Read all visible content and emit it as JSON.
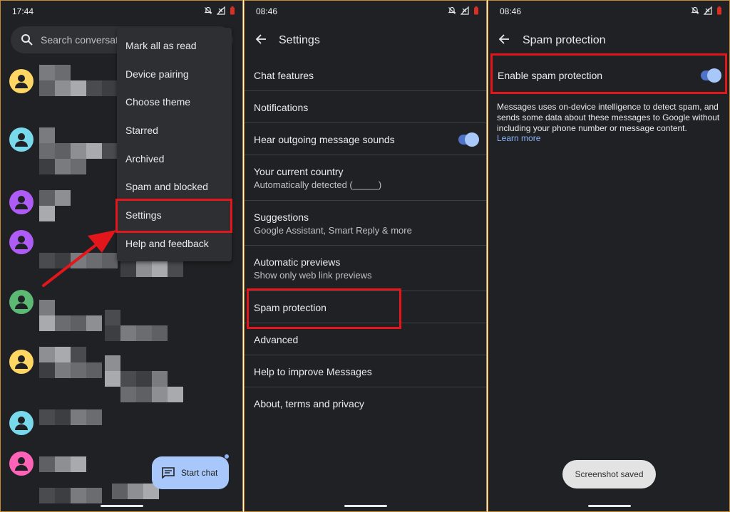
{
  "screen1": {
    "status": {
      "time": "17:44"
    },
    "search": {
      "placeholder": "Search conversati"
    },
    "avatar_colors": [
      "#fdd663",
      "#78d9ec",
      "#af5cf7",
      "#af5cf7",
      "#5bb974",
      "#fdd663",
      "#78d9ec",
      "#ff63b8"
    ],
    "menu": {
      "items": [
        "Mark all as read",
        "Device pairing",
        "Choose theme",
        "Starred",
        "Archived",
        "Spam and blocked",
        "Settings",
        "Help and feedback"
      ],
      "highlighted": "Settings"
    },
    "fab": {
      "label": "Start chat"
    }
  },
  "screen2": {
    "status": {
      "time": "08:46"
    },
    "title": "Settings",
    "rows": [
      {
        "title": "Chat features"
      },
      {
        "title": "Notifications"
      },
      {
        "title": "Hear outgoing message sounds",
        "toggle": true
      },
      {
        "title": "Your current country",
        "subtitle": "Automatically detected (_____)"
      },
      {
        "title": "Suggestions",
        "subtitle": "Google Assistant, Smart Reply & more"
      },
      {
        "title": "Automatic previews",
        "subtitle": "Show only web link previews"
      },
      {
        "title": "Spam protection",
        "highlighted": true
      },
      {
        "title": "Advanced"
      },
      {
        "title": "Help to improve Messages"
      },
      {
        "title": "About, terms and privacy"
      }
    ]
  },
  "screen3": {
    "status": {
      "time": "08:46"
    },
    "title": "Spam protection",
    "setting": {
      "label": "Enable spam protection",
      "enabled": true
    },
    "description": "Messages uses on-device intelligence to detect spam, and sends some data about these messages to Google without including your phone number or message content.",
    "link": "Learn more",
    "toast": "Screenshot saved"
  },
  "colors": {
    "background": "#202124",
    "highlight": "#e2161b",
    "accent": "#8ab4f8",
    "fab": "#a8c7fa"
  }
}
